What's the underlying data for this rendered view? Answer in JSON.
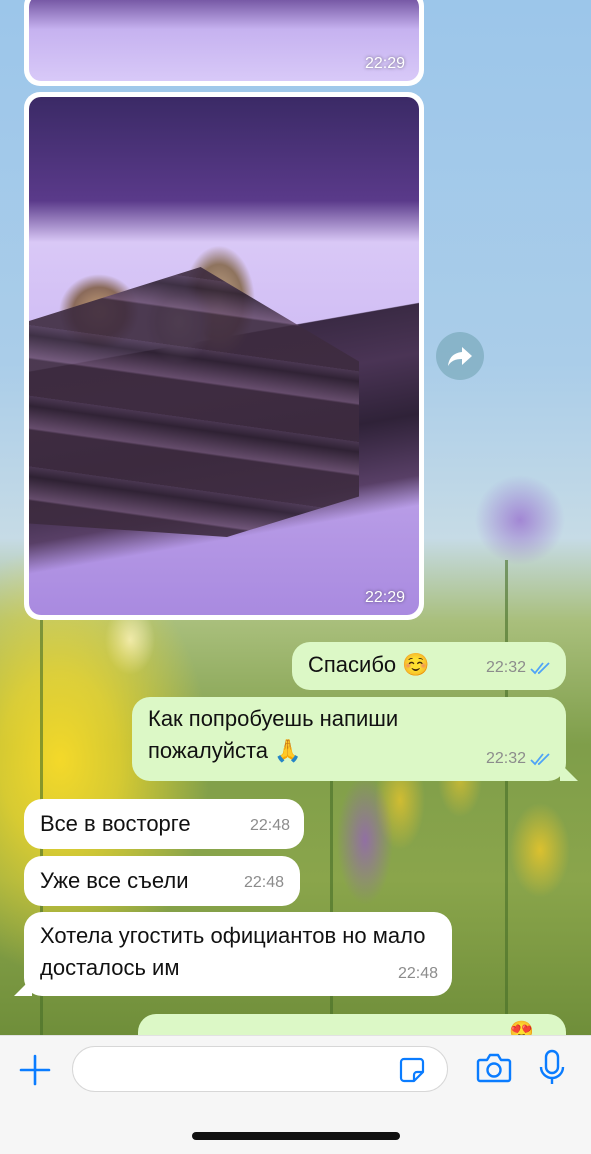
{
  "messages": {
    "image_1": {
      "time": "22:29"
    },
    "image_2": {
      "time": "22:29"
    },
    "thanks": {
      "text": "Спасибо ☺️",
      "time": "22:32"
    },
    "try_it": {
      "text": "Как попробуешь напиши пожалуйста 🙏",
      "time": "22:32"
    },
    "delight": {
      "text": "Все в восторге",
      "time": "22:48"
    },
    "eaten": {
      "text": "Уже все съели",
      "time": "22:48"
    },
    "waiters": {
      "text": "Хотела угостить официантов но мало досталось им",
      "time": "22:48"
    },
    "partial": {
      "text": "😍"
    }
  },
  "composer": {
    "placeholder": ""
  },
  "icons": [
    "plus-icon",
    "sticker-icon",
    "camera-icon",
    "microphone-icon",
    "forward-icon",
    "double-check-icon"
  ],
  "colors": {
    "outgoing_bubble": "#dcf8c6",
    "incoming_bubble": "#ffffff",
    "read_check": "#4fa3f7",
    "accent": "#0a7cff"
  }
}
